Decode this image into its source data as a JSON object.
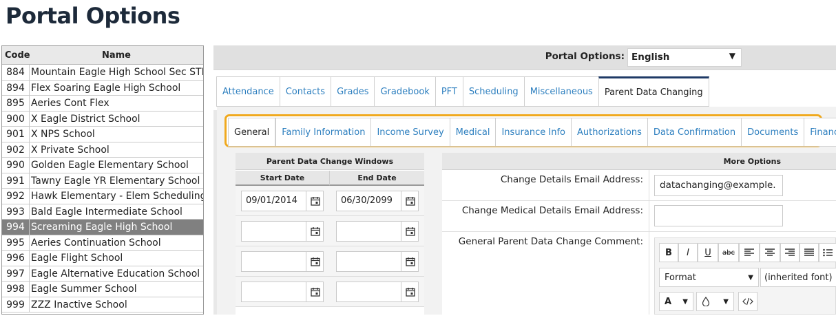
{
  "page": {
    "title": "Portal Options"
  },
  "school_list": {
    "columns": {
      "code": "Code",
      "name": "Name"
    },
    "rows": [
      {
        "code": "884",
        "name": "Mountain Eagle High School Sec STF"
      },
      {
        "code": "894",
        "name": "Flex Soaring Eagle High School"
      },
      {
        "code": "895",
        "name": "Aeries Cont Flex"
      },
      {
        "code": "900",
        "name": "X Eagle District School"
      },
      {
        "code": "901",
        "name": "X NPS School"
      },
      {
        "code": "902",
        "name": "X Private School"
      },
      {
        "code": "990",
        "name": "Golden Eagle Elementary School"
      },
      {
        "code": "991",
        "name": "Tawny Eagle YR Elementary School"
      },
      {
        "code": "992",
        "name": "Hawk Elementary - Elem Scheduling"
      },
      {
        "code": "993",
        "name": "Bald Eagle Intermediate School"
      },
      {
        "code": "994",
        "name": "Screaming Eagle High School"
      },
      {
        "code": "995",
        "name": "Aeries Continuation School"
      },
      {
        "code": "996",
        "name": "Eagle Flight School"
      },
      {
        "code": "997",
        "name": "Eagle Alternative Education School"
      },
      {
        "code": "998",
        "name": "Eagle Summer School"
      },
      {
        "code": "999",
        "name": "ZZZ Inactive School"
      }
    ],
    "selected_code": "994"
  },
  "portal_options": {
    "label": "Portal Options:",
    "language": "English"
  },
  "main_tabs": [
    {
      "label": "Attendance"
    },
    {
      "label": "Contacts"
    },
    {
      "label": "Grades"
    },
    {
      "label": "Gradebook"
    },
    {
      "label": "PFT"
    },
    {
      "label": "Scheduling"
    },
    {
      "label": "Miscellaneous"
    },
    {
      "label": "Parent Data Changing"
    }
  ],
  "sub_tabs": [
    {
      "label": "General"
    },
    {
      "label": "Family Information"
    },
    {
      "label": "Income Survey"
    },
    {
      "label": "Medical"
    },
    {
      "label": "Insurance Info"
    },
    {
      "label": "Authorizations"
    },
    {
      "label": "Data Confirmation"
    },
    {
      "label": "Documents"
    },
    {
      "label": "Financials"
    }
  ],
  "date_windows": {
    "title": "Parent Data Change Windows",
    "start_header": "Start Date",
    "end_header": "End Date",
    "rows": [
      {
        "start": "09/01/2014",
        "end": "06/30/2099"
      },
      {
        "start": "",
        "end": ""
      },
      {
        "start": "",
        "end": ""
      },
      {
        "start": "",
        "end": ""
      }
    ]
  },
  "more_options": {
    "title": "More Options",
    "change_email_label": "Change Details Email Address:",
    "change_email_value": "datachanging@example.",
    "medical_email_label": "Change Medical Details Email Address:",
    "medical_email_value": "",
    "comment_label": "General Parent Data Change Comment:",
    "editor": {
      "bold": "B",
      "italic": "I",
      "underline": "U",
      "strike": "abc",
      "format": "Format",
      "font": "(inherited font)",
      "text_color": "A"
    }
  },
  "colors": {
    "highlight": "#f0a91e",
    "tab_link": "#2d7fbf",
    "selected_row": "#808080"
  }
}
